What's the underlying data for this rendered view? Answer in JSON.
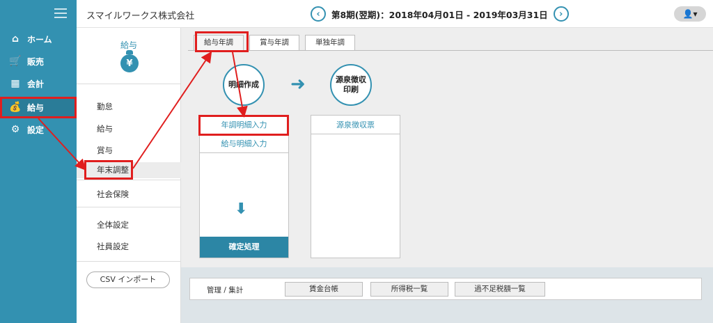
{
  "leftnav": {
    "items": [
      {
        "label": "ホーム",
        "icon": "home-icon"
      },
      {
        "label": "販売",
        "icon": "cart-icon"
      },
      {
        "label": "会計",
        "icon": "calculator-icon"
      },
      {
        "label": "給与",
        "icon": "money-bag-icon"
      },
      {
        "label": "設定",
        "icon": "gear-icon"
      }
    ]
  },
  "header": {
    "company": "スマイルワークス株式会社",
    "period": "第8期(翌期)：2018年04月01日 - 2019年03月31日",
    "prev": "‹",
    "next": "›",
    "user_icon": "👤▾"
  },
  "subnav": {
    "title": "給与",
    "yen": "¥",
    "items": [
      "勤怠",
      "給与",
      "賞与",
      "年末調整",
      "社会保険",
      "全体設定",
      "社員設定"
    ],
    "csv_button": "CSV インポート"
  },
  "main": {
    "tabs": [
      "給与年調",
      "賞与年調",
      "単独年調"
    ],
    "step1": "明細作成",
    "step2_line1": "源泉徴収",
    "step2_line2": "印刷",
    "panel1_link1": "年調明細入力",
    "panel1_link2": "給与明細入力",
    "confirm": "確定処理",
    "panel2_link1": "源泉徴収票",
    "mgmt_label": "管理 / 集計",
    "mgmt_buttons": [
      "賃金台帳",
      "所得税一覧",
      "過不足税額一覧"
    ]
  },
  "colors": {
    "accent": "#3391b1",
    "annotation": "#e01e1e"
  }
}
